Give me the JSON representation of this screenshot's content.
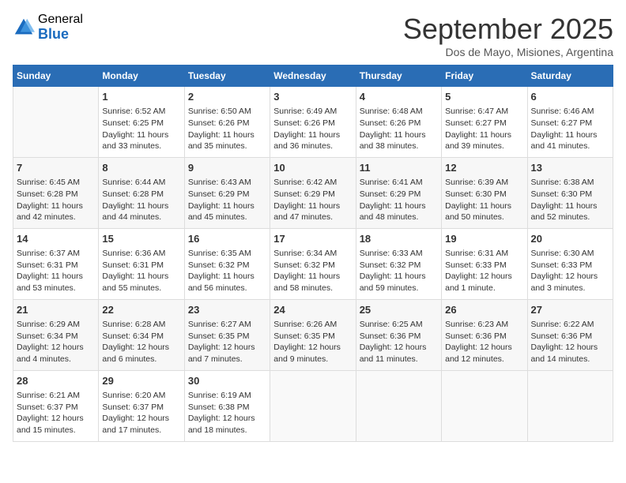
{
  "logo": {
    "general": "General",
    "blue": "Blue"
  },
  "title": "September 2025",
  "subtitle": "Dos de Mayo, Misiones, Argentina",
  "days_header": [
    "Sunday",
    "Monday",
    "Tuesday",
    "Wednesday",
    "Thursday",
    "Friday",
    "Saturday"
  ],
  "weeks": [
    [
      {
        "day": "",
        "info": ""
      },
      {
        "day": "1",
        "info": "Sunrise: 6:52 AM\nSunset: 6:25 PM\nDaylight: 11 hours\nand 33 minutes."
      },
      {
        "day": "2",
        "info": "Sunrise: 6:50 AM\nSunset: 6:26 PM\nDaylight: 11 hours\nand 35 minutes."
      },
      {
        "day": "3",
        "info": "Sunrise: 6:49 AM\nSunset: 6:26 PM\nDaylight: 11 hours\nand 36 minutes."
      },
      {
        "day": "4",
        "info": "Sunrise: 6:48 AM\nSunset: 6:26 PM\nDaylight: 11 hours\nand 38 minutes."
      },
      {
        "day": "5",
        "info": "Sunrise: 6:47 AM\nSunset: 6:27 PM\nDaylight: 11 hours\nand 39 minutes."
      },
      {
        "day": "6",
        "info": "Sunrise: 6:46 AM\nSunset: 6:27 PM\nDaylight: 11 hours\nand 41 minutes."
      }
    ],
    [
      {
        "day": "7",
        "info": "Sunrise: 6:45 AM\nSunset: 6:28 PM\nDaylight: 11 hours\nand 42 minutes."
      },
      {
        "day": "8",
        "info": "Sunrise: 6:44 AM\nSunset: 6:28 PM\nDaylight: 11 hours\nand 44 minutes."
      },
      {
        "day": "9",
        "info": "Sunrise: 6:43 AM\nSunset: 6:29 PM\nDaylight: 11 hours\nand 45 minutes."
      },
      {
        "day": "10",
        "info": "Sunrise: 6:42 AM\nSunset: 6:29 PM\nDaylight: 11 hours\nand 47 minutes."
      },
      {
        "day": "11",
        "info": "Sunrise: 6:41 AM\nSunset: 6:29 PM\nDaylight: 11 hours\nand 48 minutes."
      },
      {
        "day": "12",
        "info": "Sunrise: 6:39 AM\nSunset: 6:30 PM\nDaylight: 11 hours\nand 50 minutes."
      },
      {
        "day": "13",
        "info": "Sunrise: 6:38 AM\nSunset: 6:30 PM\nDaylight: 11 hours\nand 52 minutes."
      }
    ],
    [
      {
        "day": "14",
        "info": "Sunrise: 6:37 AM\nSunset: 6:31 PM\nDaylight: 11 hours\nand 53 minutes."
      },
      {
        "day": "15",
        "info": "Sunrise: 6:36 AM\nSunset: 6:31 PM\nDaylight: 11 hours\nand 55 minutes."
      },
      {
        "day": "16",
        "info": "Sunrise: 6:35 AM\nSunset: 6:32 PM\nDaylight: 11 hours\nand 56 minutes."
      },
      {
        "day": "17",
        "info": "Sunrise: 6:34 AM\nSunset: 6:32 PM\nDaylight: 11 hours\nand 58 minutes."
      },
      {
        "day": "18",
        "info": "Sunrise: 6:33 AM\nSunset: 6:32 PM\nDaylight: 11 hours\nand 59 minutes."
      },
      {
        "day": "19",
        "info": "Sunrise: 6:31 AM\nSunset: 6:33 PM\nDaylight: 12 hours\nand 1 minute."
      },
      {
        "day": "20",
        "info": "Sunrise: 6:30 AM\nSunset: 6:33 PM\nDaylight: 12 hours\nand 3 minutes."
      }
    ],
    [
      {
        "day": "21",
        "info": "Sunrise: 6:29 AM\nSunset: 6:34 PM\nDaylight: 12 hours\nand 4 minutes."
      },
      {
        "day": "22",
        "info": "Sunrise: 6:28 AM\nSunset: 6:34 PM\nDaylight: 12 hours\nand 6 minutes."
      },
      {
        "day": "23",
        "info": "Sunrise: 6:27 AM\nSunset: 6:35 PM\nDaylight: 12 hours\nand 7 minutes."
      },
      {
        "day": "24",
        "info": "Sunrise: 6:26 AM\nSunset: 6:35 PM\nDaylight: 12 hours\nand 9 minutes."
      },
      {
        "day": "25",
        "info": "Sunrise: 6:25 AM\nSunset: 6:36 PM\nDaylight: 12 hours\nand 11 minutes."
      },
      {
        "day": "26",
        "info": "Sunrise: 6:23 AM\nSunset: 6:36 PM\nDaylight: 12 hours\nand 12 minutes."
      },
      {
        "day": "27",
        "info": "Sunrise: 6:22 AM\nSunset: 6:36 PM\nDaylight: 12 hours\nand 14 minutes."
      }
    ],
    [
      {
        "day": "28",
        "info": "Sunrise: 6:21 AM\nSunset: 6:37 PM\nDaylight: 12 hours\nand 15 minutes."
      },
      {
        "day": "29",
        "info": "Sunrise: 6:20 AM\nSunset: 6:37 PM\nDaylight: 12 hours\nand 17 minutes."
      },
      {
        "day": "30",
        "info": "Sunrise: 6:19 AM\nSunset: 6:38 PM\nDaylight: 12 hours\nand 18 minutes."
      },
      {
        "day": "",
        "info": ""
      },
      {
        "day": "",
        "info": ""
      },
      {
        "day": "",
        "info": ""
      },
      {
        "day": "",
        "info": ""
      }
    ]
  ]
}
